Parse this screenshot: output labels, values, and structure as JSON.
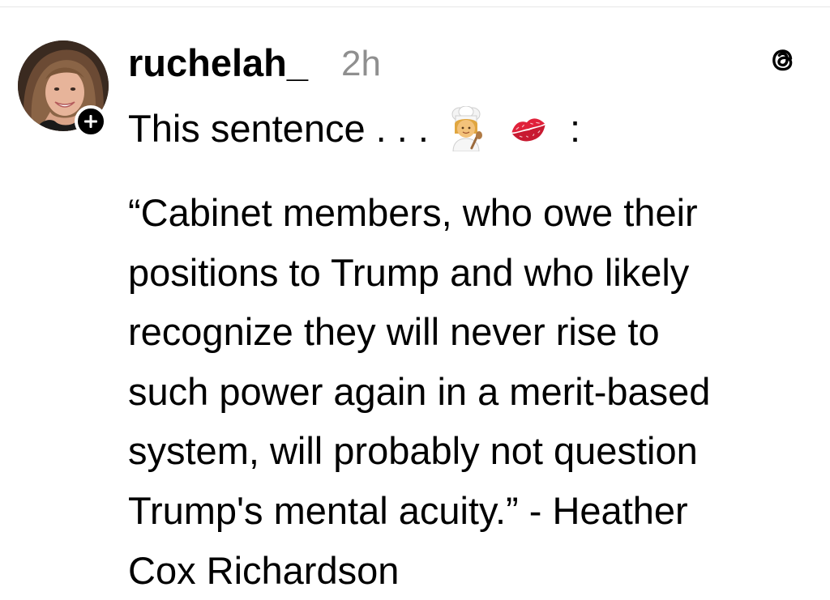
{
  "post": {
    "username": "ruchelah_",
    "timestamp": "2h",
    "intro_text": "This sentence . . .",
    "intro_emojis": [
      "woman-cook-emoji",
      "kiss-mark-emoji"
    ],
    "intro_suffix": ":",
    "body_lines": [
      "“Cabinet members, who owe their",
      "positions to Trump and who likely",
      "recognize they will never rise to",
      "such power again in a merit-based",
      "system, will probably not question",
      "Trump's mental acuity.” - Heather",
      "Cox Richardson"
    ]
  },
  "icons": {
    "follow": "plus-icon",
    "app": "threads-logo-icon"
  },
  "colors": {
    "text": "#000000",
    "timestamp": "#8f8f8f",
    "badge": "#000000",
    "background": "#ffffff"
  }
}
